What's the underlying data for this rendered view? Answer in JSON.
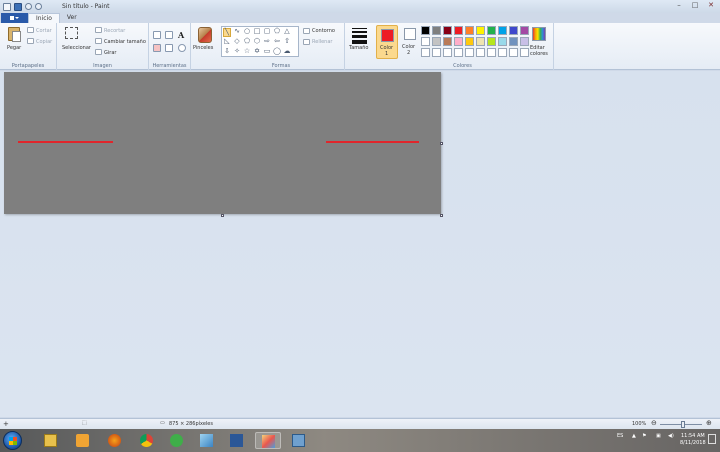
{
  "window": {
    "title": "Sin título - Paint"
  },
  "tabs": {
    "home": "Inicio",
    "view": "Ver"
  },
  "ribbon": {
    "clipboard": {
      "paste": "Pegar",
      "cut": "Cortar",
      "copy": "Copiar",
      "group": "Portapapeles"
    },
    "image": {
      "select": "Seleccionar",
      "crop": "Recortar",
      "resize": "Cambiar tamaño",
      "rotate": "Girar",
      "group": "Imagen"
    },
    "tools": {
      "group": "Herramientas"
    },
    "brushes": {
      "label": "Pinceles"
    },
    "shapes": {
      "outline": "Contorno",
      "fill": "Rellenar",
      "group": "Formas"
    },
    "size": {
      "label": "Tamaño"
    },
    "colors": {
      "color1_label": "Color",
      "color1_num": "1",
      "color2_label": "Color",
      "color2_num": "2",
      "edit_line1": "Editar",
      "edit_line2": "colores",
      "group": "Colores",
      "color1_value": "#ed1c24",
      "color2_value": "#ffffff",
      "palette_row1": [
        "#000000",
        "#7f7f7f",
        "#880015",
        "#ed1c24",
        "#ff7f27",
        "#fff200",
        "#22b14c",
        "#00a2e8",
        "#3f48cc",
        "#a349a4"
      ],
      "palette_row2": [
        "#ffffff",
        "#c3c3c3",
        "#b97a57",
        "#ffaec9",
        "#ffc90e",
        "#efe4b0",
        "#b5e61d",
        "#99d9ea",
        "#7092be",
        "#c8bfe7"
      ],
      "palette_row3": [
        "#ffffff",
        "#ffffff",
        "#ffffff",
        "#ffffff",
        "#ffffff",
        "#ffffff",
        "#ffffff",
        "#ffffff",
        "#ffffff",
        "#ffffff"
      ]
    }
  },
  "canvas": {
    "background": "#7f7f7f",
    "stroke_color": "#e0262c"
  },
  "status": {
    "dimensions": "875 × 286píxeles",
    "zoom": "100%"
  },
  "taskbar": {
    "language": "ES",
    "time": "11:54 AM",
    "date": "8/11/2018"
  }
}
